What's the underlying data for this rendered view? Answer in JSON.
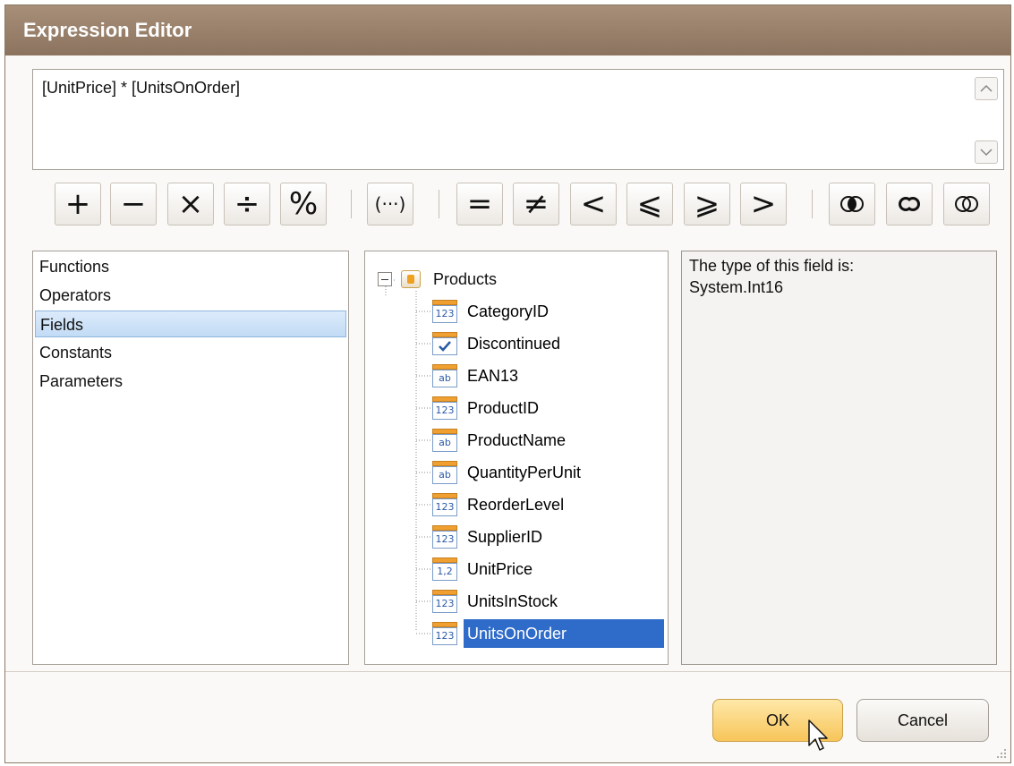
{
  "window": {
    "title": "Expression Editor"
  },
  "expression": {
    "text": "[UnitPrice] * [UnitsOnOrder]"
  },
  "operators": [
    {
      "symbol": "+",
      "name": "plus"
    },
    {
      "symbol": "−",
      "name": "minus"
    },
    {
      "symbol": "×",
      "name": "multiply"
    },
    {
      "symbol": "÷",
      "name": "divide"
    },
    {
      "symbol": "%",
      "name": "modulo"
    },
    {
      "symbol": "(···)",
      "name": "parentheses"
    },
    {
      "symbol": "=",
      "name": "equal"
    },
    {
      "symbol": "≠",
      "name": "not-equal"
    },
    {
      "symbol": "<",
      "name": "less"
    },
    {
      "symbol": "⩽",
      "name": "less-equal"
    },
    {
      "symbol": "⩾",
      "name": "greater-equal"
    },
    {
      "symbol": ">",
      "name": "greater"
    }
  ],
  "logical_icons": [
    "and-icon",
    "or-icon",
    "not-icon"
  ],
  "categories": [
    {
      "label": "Functions",
      "selected": false
    },
    {
      "label": "Operators",
      "selected": false
    },
    {
      "label": "Fields",
      "selected": true
    },
    {
      "label": "Constants",
      "selected": false
    },
    {
      "label": "Parameters",
      "selected": false
    }
  ],
  "tree": {
    "root": "Products",
    "fields": [
      {
        "name": "CategoryID",
        "icon": "123"
      },
      {
        "name": "Discontinued",
        "icon": "check"
      },
      {
        "name": "EAN13",
        "icon": "ab"
      },
      {
        "name": "ProductID",
        "icon": "123"
      },
      {
        "name": "ProductName",
        "icon": "ab"
      },
      {
        "name": "QuantityPerUnit",
        "icon": "ab"
      },
      {
        "name": "ReorderLevel",
        "icon": "123"
      },
      {
        "name": "SupplierID",
        "icon": "123"
      },
      {
        "name": "UnitPrice",
        "icon": "1,2"
      },
      {
        "name": "UnitsInStock",
        "icon": "123"
      },
      {
        "name": "UnitsOnOrder",
        "icon": "123",
        "selected": true
      }
    ]
  },
  "info": {
    "line1": "The type of this field is:",
    "line2": "System.Int16"
  },
  "buttons": {
    "ok": "OK",
    "cancel": "Cancel"
  },
  "colors": {
    "title_bar": "#9a8270",
    "selection": "#2f6bc8",
    "ok_button": "#f9cf6a"
  }
}
